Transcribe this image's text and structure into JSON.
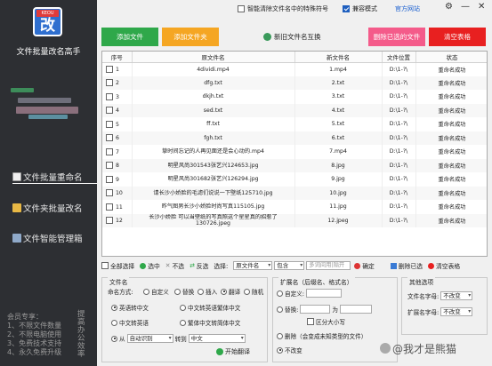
{
  "app": {
    "title": "文件批量改名高手",
    "logo_badge": "KEOU",
    "logo_glyph": "改"
  },
  "sidebar": {
    "nav": [
      {
        "label": "文件批量重命名",
        "active": true
      },
      {
        "label": "文件夹批量改名",
        "active": false
      },
      {
        "label": "文件智能管理箱",
        "active": false
      }
    ],
    "footer_lines": [
      "会员专享：",
      "1、不限文件数量",
      "2、不限电脑使用",
      "3、免费技术支持",
      "4、永久免费升级"
    ],
    "footer_side": "提高办公效率"
  },
  "topbar": {
    "smart_clean": "智能清除文件名中的特殊符号",
    "pro_mode": "兼容模式",
    "site_link": "官方网站",
    "window_buttons": [
      "⚙",
      "—",
      "✕"
    ]
  },
  "toolbar": {
    "add_file": "添加文件",
    "add_folder": "添加文件夹",
    "history": "新旧文件名互换",
    "delete_selected": "删除已选的文件",
    "clear_table": "清空表格"
  },
  "table": {
    "headers": [
      "序号",
      "原文件名",
      "新文件名",
      "文件位置",
      "状态"
    ],
    "rows": [
      {
        "no": "1",
        "orig": "4dividi.mp4",
        "new": "1.mp4",
        "loc": "D:\\1-?\\",
        "status": "重命名成功"
      },
      {
        "no": "2",
        "orig": "dfg.txt",
        "new": "2.txt",
        "loc": "D:\\1-?\\",
        "status": "重命名成功"
      },
      {
        "no": "3",
        "orig": "dkjh.txt",
        "new": "3.txt",
        "loc": "D:\\1-?\\",
        "status": "重命名成功"
      },
      {
        "no": "4",
        "orig": "sed.txt",
        "new": "4.txt",
        "loc": "D:\\1-?\\",
        "status": "重命名成功"
      },
      {
        "no": "5",
        "orig": "ff.txt",
        "new": "5.txt",
        "loc": "D:\\1-?\\",
        "status": "重命名成功"
      },
      {
        "no": "6",
        "orig": "fgh.txt",
        "new": "6.txt",
        "loc": "D:\\1-?\\",
        "status": "重命名成功"
      },
      {
        "no": "7",
        "orig": "挚时间忘记的人再见面还是会心动的.mp4",
        "new": "7.mp4",
        "loc": "D:\\1-?\\",
        "status": "重命名成功"
      },
      {
        "no": "8",
        "orig": "明星风尚301543张艺兴124653.jpg",
        "new": "8.jpg",
        "loc": "D:\\1-?\\",
        "status": "重命名成功"
      },
      {
        "no": "9",
        "orig": "明星风尚301682张艺兴126294.jpg",
        "new": "9.jpg",
        "loc": "D:\\1-?\\",
        "status": "重命名成功"
      },
      {
        "no": "10",
        "orig": "请长沙小娇脸的毛滤们说说一下壁纸125710.jpg",
        "new": "10.jpg",
        "loc": "D:\\1-?\\",
        "status": "重命名成功"
      },
      {
        "no": "11",
        "orig": "昨气图男长沙小娇脸时尚写真115105.jpg",
        "new": "11.jpg",
        "loc": "D:\\1-?\\",
        "status": "重命名成功"
      },
      {
        "no": "12",
        "orig": "长沙小娇脸 可以当壁纸的写真照这个星星真的招惹了 130726.jpeg",
        "new": "12.jpeg",
        "loc": "D:\\1-?\\",
        "status": "重命名成功"
      }
    ]
  },
  "filter": {
    "select_all": "全部选择",
    "select": "选中",
    "unselect": "不选",
    "invert": "反选",
    "choose_label": "选择:",
    "field_select": "原文件名",
    "op_select": "包含",
    "keyword_placeholder": "多词间用|隔开",
    "confirm": "确定",
    "delete_selected": "删除已选",
    "clear_table": "清空表格"
  },
  "filename_group": {
    "title": "文件名",
    "mode_label": "命名方式:",
    "modes": [
      "自定义",
      "替换",
      "插入",
      "翻译",
      "随机"
    ],
    "mode_selected": "翻译",
    "options": [
      "英语转中文",
      "中文转英语繁体中文",
      "中文转英语",
      "繁体中文转简体中文"
    ],
    "option_selected": "英语转中文",
    "from_label": "从",
    "from_value": "自动识别",
    "to_label": "转到",
    "to_value": "中文",
    "start_button": "开始翻译"
  },
  "ext_group": {
    "title": "扩展名（后缀名、格式名）",
    "custom_label": "自定义:",
    "replace_label": "替换:",
    "replace_mid": "为",
    "case_label": "区分大小写",
    "delete_label": "删除（会变成未知类型的文件）",
    "unchanged_label": "不改变",
    "selected": "不改变"
  },
  "other_group": {
    "title": "其他选项",
    "filename_case_label": "文件名字母:",
    "filename_case_value": "不改变",
    "ext_case_label": "扩展名字母:",
    "ext_case_value": "不改变"
  },
  "watermark": "@我才是熊猫"
}
